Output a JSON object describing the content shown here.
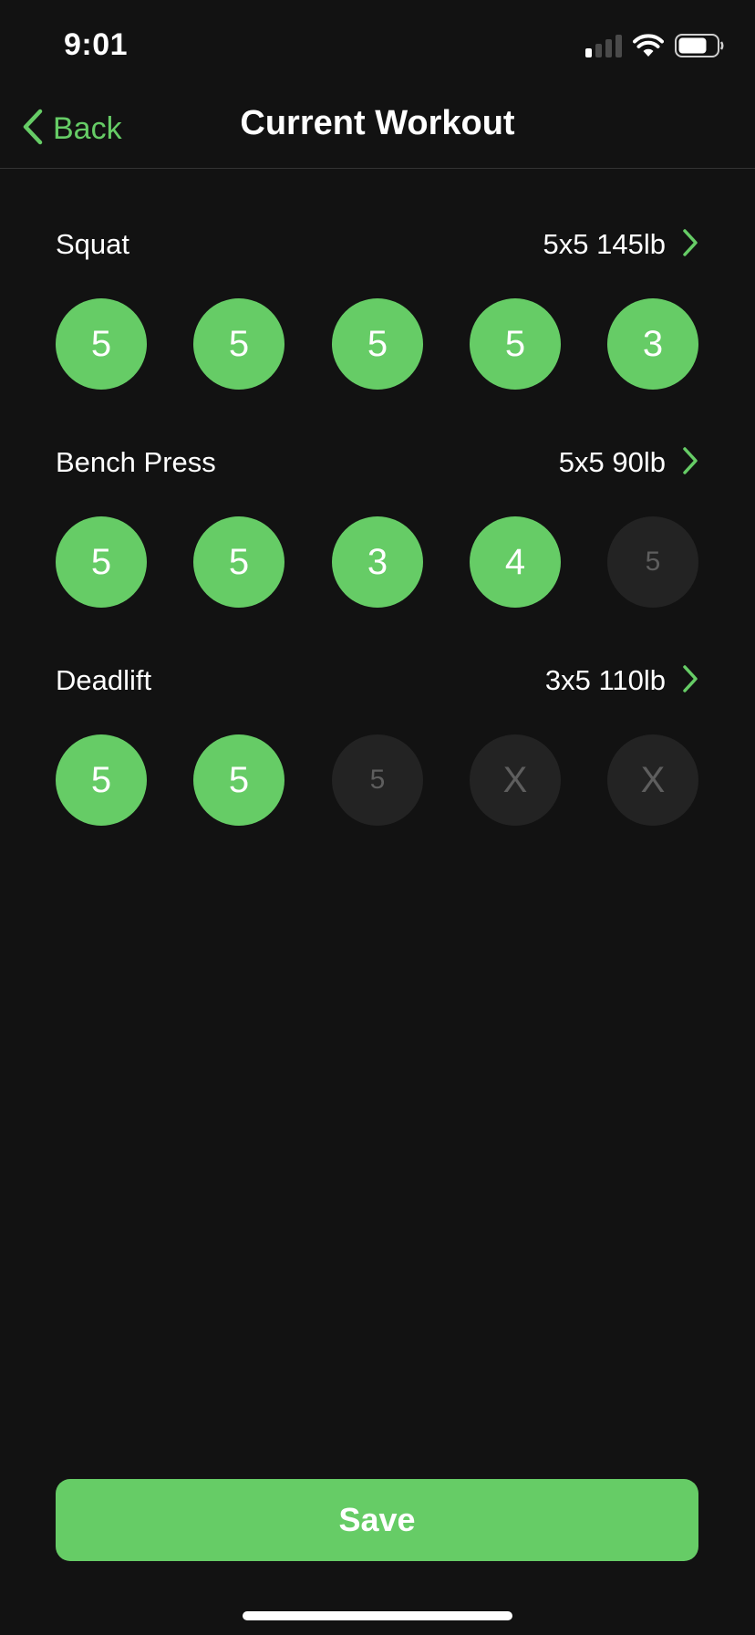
{
  "status_bar": {
    "time": "9:01",
    "signal_bars_active": 1,
    "signal_bars_total": 4,
    "battery_level": 0.75,
    "icons": [
      "cellular-signal-icon",
      "wifi-icon",
      "battery-icon"
    ]
  },
  "nav": {
    "back_label": "Back",
    "back_icon": "chevron-left-icon",
    "title": "Current Workout"
  },
  "colors": {
    "accent": "#66cc66",
    "background": "#121212",
    "inactive_circle": "#232323",
    "inactive_text": "#5e5e5e",
    "divider": "#333333"
  },
  "exercises": [
    {
      "name": "Squat",
      "scheme": "5x5 145lb",
      "sets": [
        {
          "label": "5",
          "state": "done"
        },
        {
          "label": "5",
          "state": "done"
        },
        {
          "label": "5",
          "state": "done"
        },
        {
          "label": "5",
          "state": "done"
        },
        {
          "label": "3",
          "state": "done"
        }
      ]
    },
    {
      "name": "Bench Press",
      "scheme": "5x5 90lb",
      "sets": [
        {
          "label": "5",
          "state": "done"
        },
        {
          "label": "5",
          "state": "done"
        },
        {
          "label": "3",
          "state": "done"
        },
        {
          "label": "4",
          "state": "done"
        },
        {
          "label": "5",
          "state": "pending"
        }
      ]
    },
    {
      "name": "Deadlift",
      "scheme": "3x5 110lb",
      "sets": [
        {
          "label": "5",
          "state": "done"
        },
        {
          "label": "5",
          "state": "done"
        },
        {
          "label": "5",
          "state": "pending"
        },
        {
          "label": "X",
          "state": "skipped"
        },
        {
          "label": "X",
          "state": "skipped"
        }
      ]
    }
  ],
  "save_label": "Save"
}
